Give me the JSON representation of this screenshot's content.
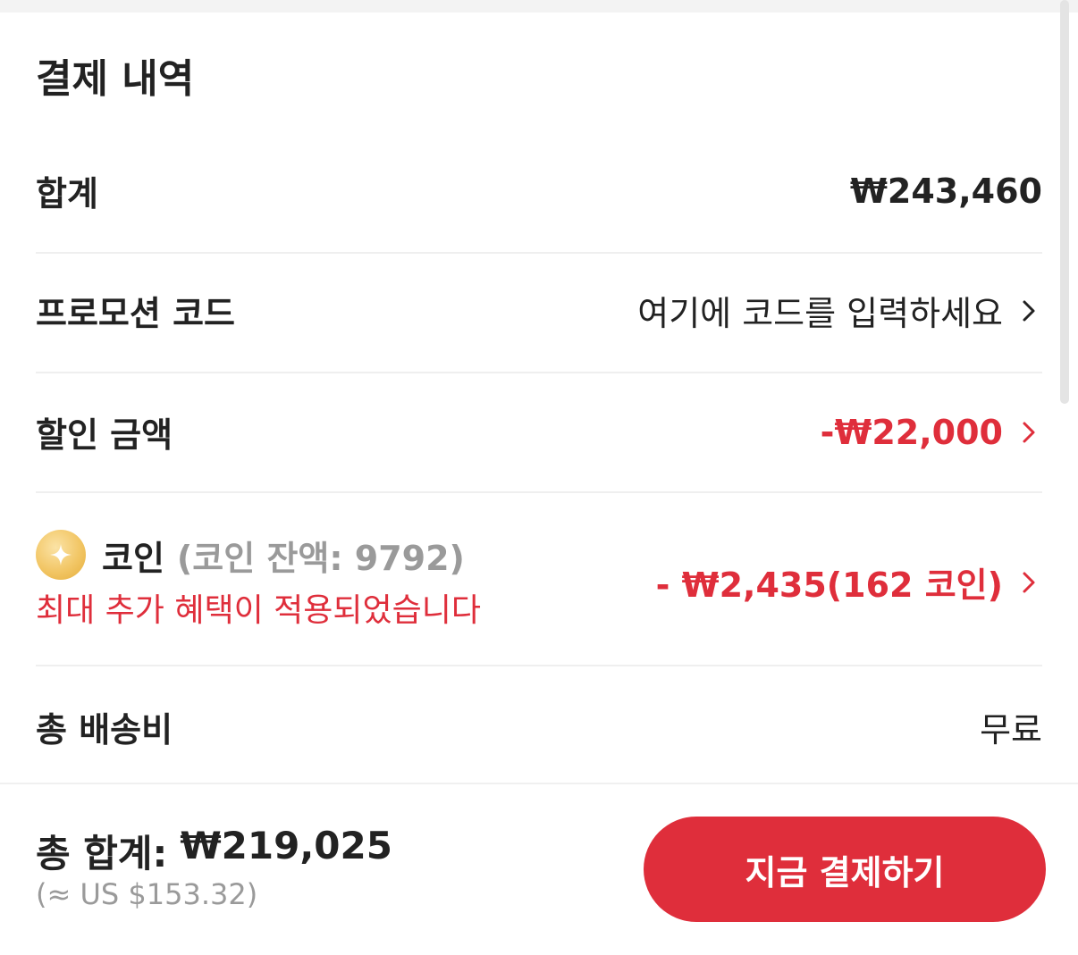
{
  "section": {
    "title": "결제 내역"
  },
  "rows": {
    "subtotal": {
      "label": "합계",
      "value": "₩243,460"
    },
    "promo": {
      "label": "프로모션 코드",
      "value": "여기에 코드를 입력하세요"
    },
    "discount": {
      "label": "할인 금액",
      "value": "-₩22,000"
    },
    "coins": {
      "label": "코인",
      "balance": "(코인 잔액: 9792)",
      "note": "최대 추가 혜택이 적용되었습니다",
      "value": "- ₩2,435(162 코인)"
    },
    "shipping": {
      "label": "총 배송비",
      "value": "무료"
    }
  },
  "footer": {
    "total_label": "총 합계:",
    "total_value": "₩219,025",
    "usd": "(≈ US $153.32)",
    "pay_button": "지금 결제하기"
  },
  "icons": {
    "chevron": "chevron-right-icon",
    "coin": "coin-icon"
  },
  "colors": {
    "accent_red": "#df2e3b",
    "text_dark": "#222222",
    "text_gray": "#9a9a9a",
    "coin_gold": "#f2c665"
  }
}
